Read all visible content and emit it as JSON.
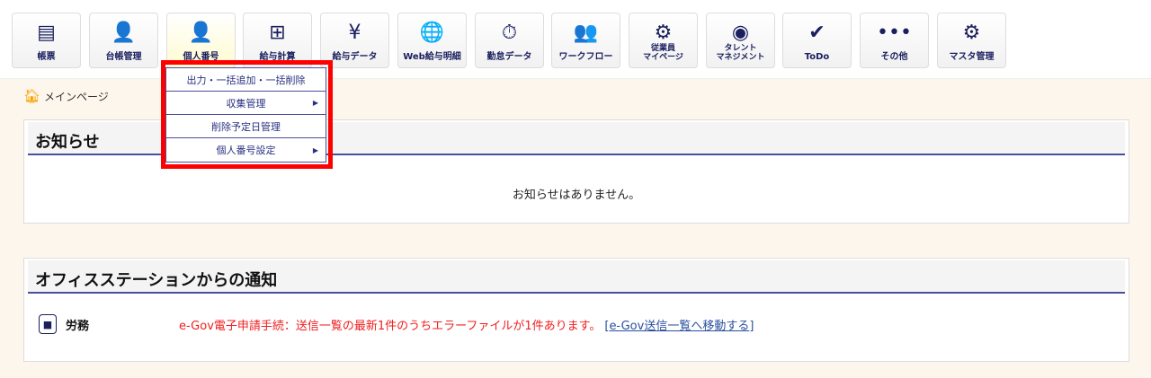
{
  "toolbar": [
    {
      "label": "帳票",
      "icon": "document-icon",
      "glyph": "▤"
    },
    {
      "label": "台帳管理",
      "icon": "ledger-icon",
      "glyph": "👤"
    },
    {
      "label": "個人番号",
      "icon": "my-number-icon",
      "glyph": "👤",
      "active": true
    },
    {
      "label": "給与計算",
      "icon": "calculator-icon",
      "glyph": "⊞"
    },
    {
      "label": "給与データ",
      "icon": "salary-data-icon",
      "glyph": "¥"
    },
    {
      "label": "Web給与明細",
      "icon": "web-payslip-icon",
      "glyph": "🌐"
    },
    {
      "label": "勤怠データ",
      "icon": "attendance-icon",
      "glyph": "⏱"
    },
    {
      "label": "ワークフロー",
      "icon": "workflow-icon",
      "glyph": "👥"
    },
    {
      "label": "従業員\nマイページ",
      "line1": "従業員",
      "line2": "マイページ",
      "icon": "employee-mypage-icon",
      "glyph": "⚙"
    },
    {
      "label": "タレント\nマネジメント",
      "line1": "タレント",
      "line2": "マネジメント",
      "icon": "talent-icon",
      "glyph": "◉"
    },
    {
      "label": "ToDo",
      "icon": "todo-icon",
      "glyph": "✔"
    },
    {
      "label": "その他",
      "icon": "more-icon",
      "glyph": "•••"
    },
    {
      "label": "マスタ管理",
      "icon": "gear-icon",
      "glyph": "⚙"
    }
  ],
  "dropdown": [
    {
      "label": "出力・一括追加・一括削除",
      "submenu": false
    },
    {
      "label": "収集管理",
      "submenu": true
    },
    {
      "label": "削除予定日管理",
      "submenu": false
    },
    {
      "label": "個人番号設定",
      "submenu": true
    }
  ],
  "breadcrumb": {
    "label": "メインページ"
  },
  "notices": {
    "title": "お知らせ",
    "empty": "お知らせはありません。"
  },
  "office": {
    "title": "オフィスステーションからの通知",
    "category": "労務",
    "message": "e-Gov電子申請手続：送信一覧の最新1件のうちエラーファイルが1件あります。",
    "link_open": "[",
    "link": "e-Gov送信一覧へ移動する",
    "link_close": "]"
  }
}
